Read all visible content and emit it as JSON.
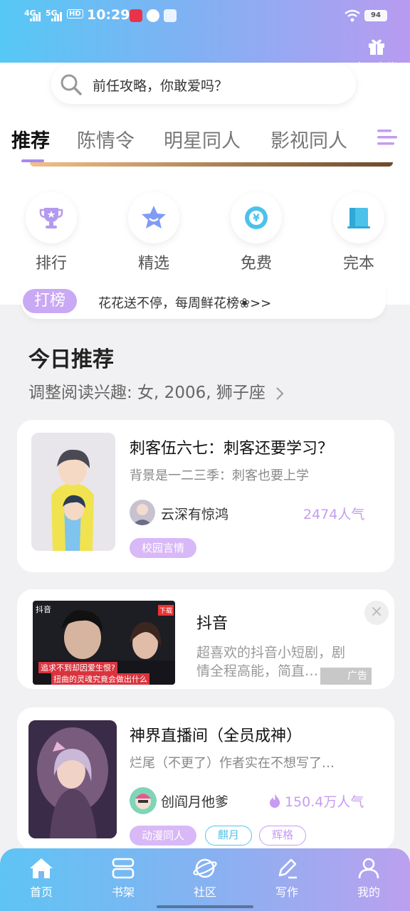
{
  "status_bar": {
    "signal1": "4G",
    "signal2": "5G",
    "hd": "HD",
    "time": "10:29",
    "battery": "94"
  },
  "gift": {
    "label": "每日有礼"
  },
  "search": {
    "placeholder": "前任攻略，你敢爱吗？"
  },
  "tabs": [
    {
      "label": "推荐",
      "active": true
    },
    {
      "label": "陈情令",
      "active": false
    },
    {
      "label": "明星同人",
      "active": false
    },
    {
      "label": "影视同人",
      "active": false
    }
  ],
  "quick_nav": [
    {
      "label": "排行",
      "icon": "trophy-icon"
    },
    {
      "label": "精选",
      "icon": "star-icon"
    },
    {
      "label": "免费",
      "icon": "free-yen-icon"
    },
    {
      "label": "完本",
      "icon": "book-icon"
    }
  ],
  "rank_bar": {
    "tag": "打榜",
    "text": "花花送不停，每周鲜花榜❀>>"
  },
  "today": {
    "title": "今日推荐",
    "subtitle": "调整阅读兴趣: 女, 2006, 狮子座"
  },
  "books": [
    {
      "title": "刺客伍六七：刺客还要学习？",
      "desc": "背景是一二三季：刺客也要上学",
      "author": "云深有惊鸿",
      "popularity": "2474人气",
      "tags": [
        "校园言情"
      ]
    },
    {
      "title": "神界直播间（全员成神）",
      "desc": "烂尾（不更了）作者实在不想写了…",
      "author": "创阎月他爹",
      "popularity": "150.4万人气",
      "tags": [
        "动漫同人",
        "麒月",
        "辉格"
      ]
    }
  ],
  "ad": {
    "title": "抖音",
    "desc": "超喜欢的抖音小短剧，剧情全程高能，简直…",
    "badge": "广告",
    "image_caption_1": "追求不到却因爱生恨?",
    "image_caption_2": "扭曲的灵魂究竟会做出什么",
    "image_brand": "抖音",
    "image_sticker": "下载"
  },
  "bottom_nav": [
    {
      "label": "首页",
      "icon": "home-icon"
    },
    {
      "label": "书架",
      "icon": "bookshelf-icon"
    },
    {
      "label": "社区",
      "icon": "planet-icon"
    },
    {
      "label": "写作",
      "icon": "pen-icon"
    },
    {
      "label": "我的",
      "icon": "user-icon"
    }
  ],
  "colors": {
    "accent_purple": "#c59cf0",
    "accent_blue": "#59c2e8",
    "header_gradient_start": "#56c8f5",
    "header_gradient_end": "#b89bf0"
  }
}
